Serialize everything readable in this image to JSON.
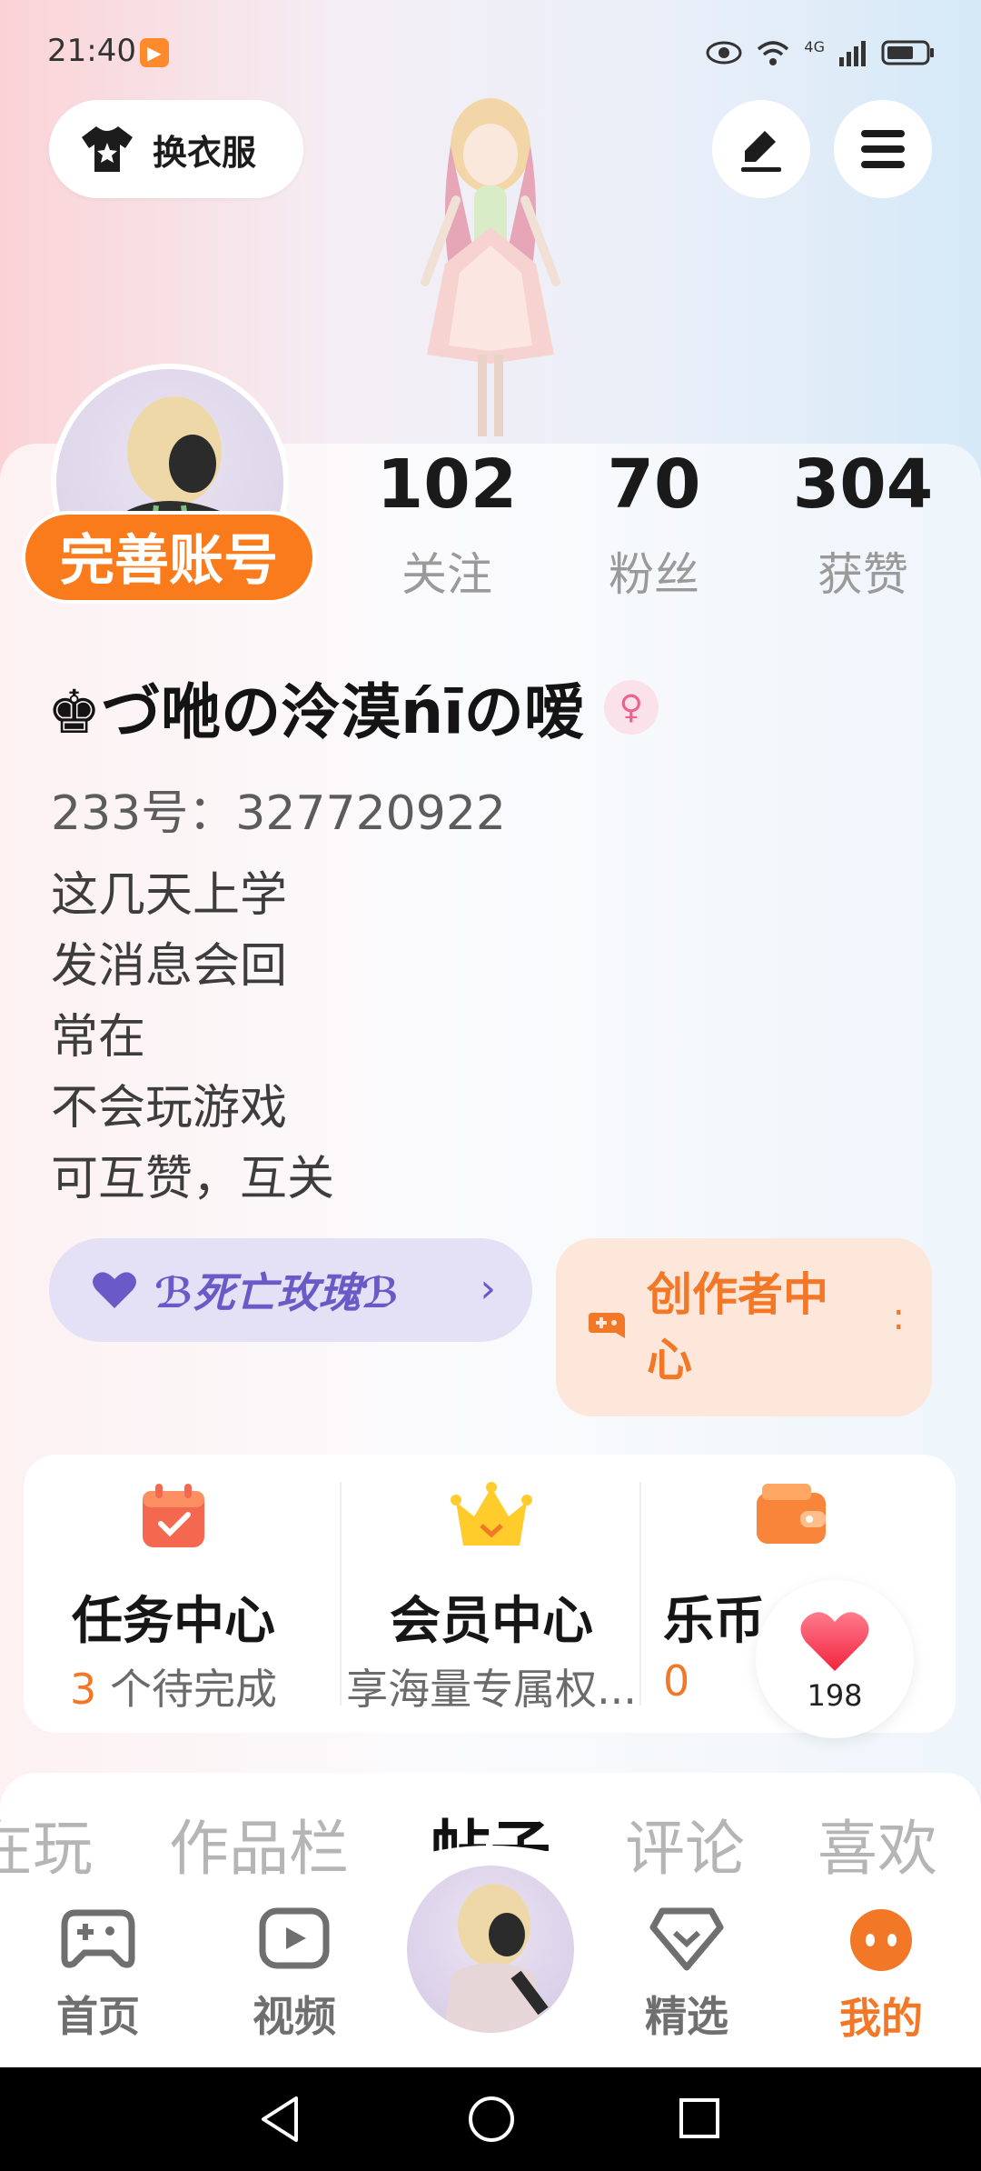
{
  "status_bar": {
    "time": "21:40",
    "network": "4G"
  },
  "header": {
    "outfit_label": "换衣服"
  },
  "profile": {
    "complete_label": "完善账号",
    "stats": [
      {
        "value": "102",
        "label": "关注"
      },
      {
        "value": "70",
        "label": "粉丝"
      },
      {
        "value": "304",
        "label": "获赞"
      }
    ],
    "username": "♚づ咃の泠漠ńīの嗳",
    "user_id": "233号：327720922",
    "bio": [
      "这几天上学",
      "发消息会回",
      "常在",
      "不会玩游戏",
      "可互赞，互关"
    ]
  },
  "chips": {
    "group_label": "ℬ死亡玫瑰ℬ",
    "creator_label": "创作者中心"
  },
  "features": [
    {
      "title": "任务中心",
      "sub_count": "3",
      "sub_text": " 个待完成"
    },
    {
      "title": "会员中心",
      "sub_text": "享海量专属权..."
    },
    {
      "title": "乐币",
      "sub_count": "0"
    }
  ],
  "likes": {
    "count": "198"
  },
  "tabs": [
    "在玩",
    "作品栏",
    "帖子",
    "评论",
    "喜欢"
  ],
  "active_tab": "帖子",
  "bottom_nav": [
    {
      "label": "首页"
    },
    {
      "label": "视频"
    },
    {
      "label": "精选"
    },
    {
      "label": "我的"
    }
  ],
  "colors": {
    "accent": "#f97b1c",
    "group_purple": "#6a5ac8",
    "creator_orange": "#f27726"
  },
  "icons": [
    "tshirt-icon",
    "edit-icon",
    "menu-icon",
    "heart-icon",
    "gamepad-icon",
    "video-icon",
    "diamond-heart-icon",
    "face-icon"
  ]
}
